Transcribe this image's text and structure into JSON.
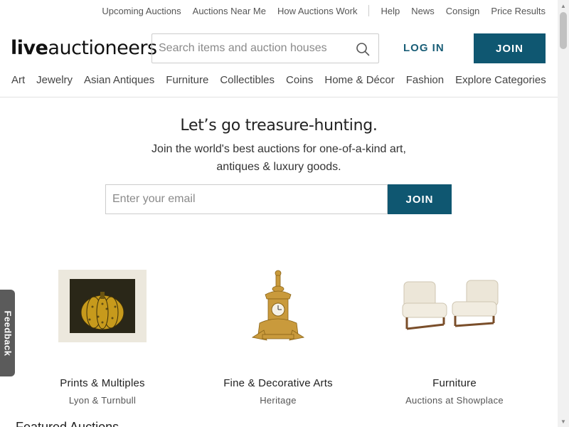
{
  "util_bar": {
    "left_links": [
      "Upcoming Auctions",
      "Auctions Near Me",
      "How Auctions Work"
    ],
    "right_links": [
      "Help",
      "News",
      "Consign",
      "Price Results"
    ]
  },
  "header": {
    "logo_bold": "live",
    "logo_rest": "auctioneers",
    "search_placeholder": "Search items and auction houses",
    "login_label": "LOG IN",
    "join_label": "JOIN"
  },
  "categories": [
    "Art",
    "Jewelry",
    "Asian Antiques",
    "Furniture",
    "Collectibles",
    "Coins",
    "Home & Décor",
    "Fashion",
    "Explore Categories"
  ],
  "hero": {
    "title": "Let’s go treasure-hunting.",
    "subtitle_line1": "Join the world's best auctions for one-of-a-kind art,",
    "subtitle_line2": "antiques & luxury goods.",
    "email_placeholder": "Enter your email",
    "join_label": "JOIN"
  },
  "cards": [
    {
      "title": "Prints & Multiples",
      "subtitle": "Lyon & Turnbull",
      "icon": "pumpkin-print-image"
    },
    {
      "title": "Fine & Decorative Arts",
      "subtitle": "Heritage",
      "icon": "ornate-clock-image"
    },
    {
      "title": "Furniture",
      "subtitle": "Auctions at Showplace",
      "icon": "lounge-chairs-image"
    }
  ],
  "feedback_label": "Feedback",
  "partial_heading": "Featured Auctions",
  "colors": {
    "brand": "#0f5771",
    "login_text": "#1a5e77",
    "feedback_bg": "#5b5b5b"
  }
}
